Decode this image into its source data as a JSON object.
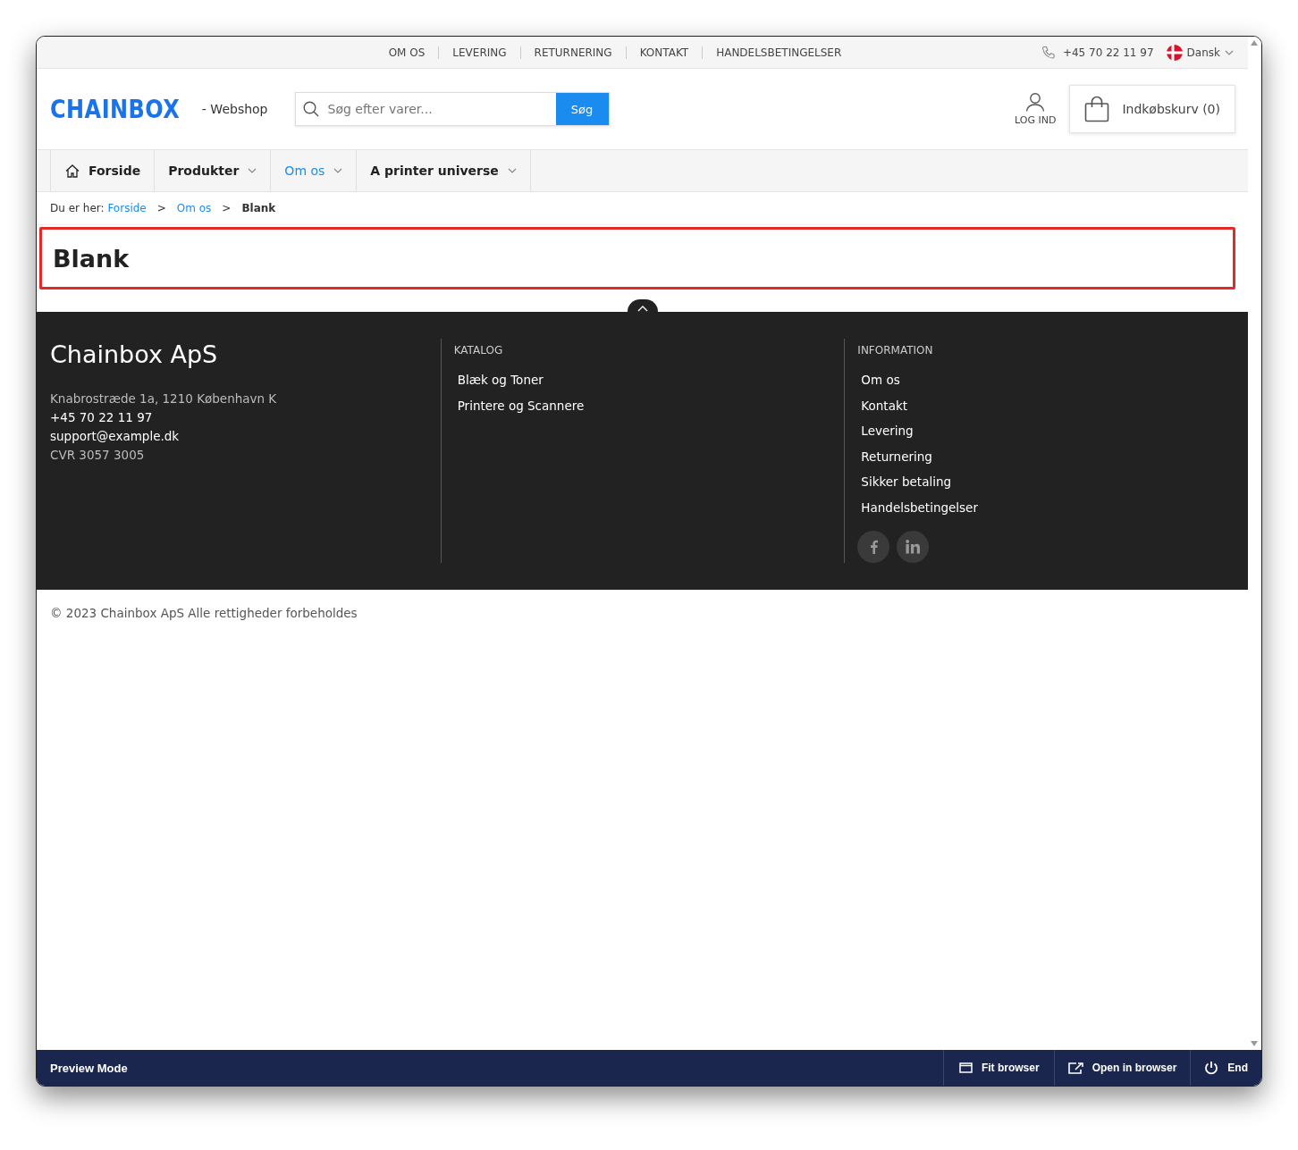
{
  "top_links": [
    "OM OS",
    "LEVERING",
    "RETURNERING",
    "KONTAKT",
    "HANDELSBETINGELSER"
  ],
  "phone": "+45 70 22 11 97",
  "language": "Dansk",
  "logo": "CHAINBOX",
  "tagline": "- Webshop",
  "search": {
    "placeholder": "Søg efter varer...",
    "button": "Søg"
  },
  "login": "LOG IND",
  "cart": "Indkøbskurv (0)",
  "nav": [
    {
      "label": "Forside",
      "kind": "home",
      "selected": false
    },
    {
      "label": "Produkter",
      "kind": "dropdown",
      "selected": false
    },
    {
      "label": "Om os",
      "kind": "dropdown",
      "selected": true
    },
    {
      "label": "A printer universe",
      "kind": "dropdown",
      "selected": false
    }
  ],
  "breadcrumb": {
    "prefix": "Du er her:",
    "items": [
      {
        "label": "Forside",
        "current": false
      },
      {
        "label": "Om os",
        "current": false
      },
      {
        "label": "Blank",
        "current": true
      }
    ],
    "separator": ">"
  },
  "page_title": "Blank",
  "footer": {
    "company": "Chainbox ApS",
    "address": "Knabrostræde 1a, 1210 København K",
    "phone": "+45 70 22 11 97",
    "email": "support@example.dk",
    "cvr": "CVR 3057 3005",
    "columns": [
      {
        "title": "KATALOG",
        "links": [
          "Blæk og Toner",
          "Printere og Scannere"
        ]
      },
      {
        "title": "INFORMATION",
        "links": [
          "Om os",
          "Kontakt",
          "Levering",
          "Returnering",
          "Sikker betaling",
          "Handelsbetingelser"
        ],
        "social": [
          {
            "kind": "facebook"
          },
          {
            "kind": "linkedin"
          }
        ]
      }
    ]
  },
  "copyright": "© 2023 Chainbox ApS Alle rettigheder forbeholdes",
  "preview_bar": {
    "title": "Preview Mode",
    "buttons": [
      {
        "label": "Fit browser",
        "kind": "fit"
      },
      {
        "label": "Open in browser",
        "kind": "open"
      },
      {
        "label": "End",
        "kind": "end"
      }
    ]
  }
}
